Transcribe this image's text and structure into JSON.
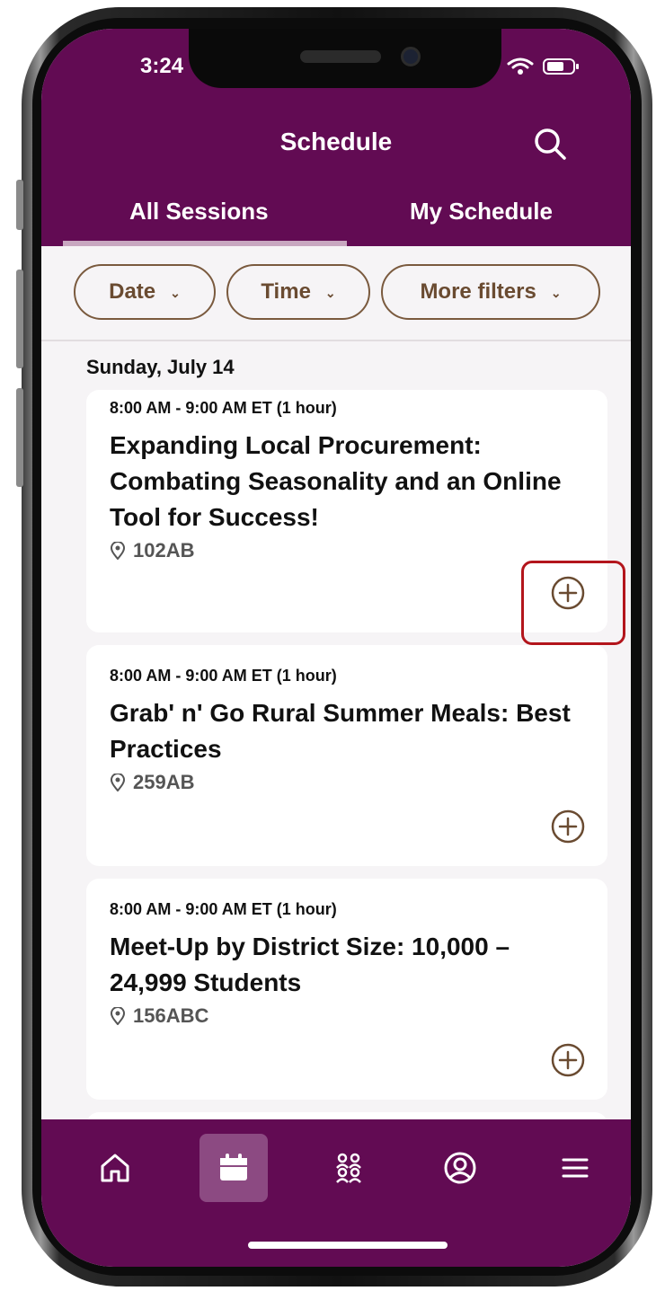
{
  "status": {
    "time": "3:24"
  },
  "header": {
    "title": "Schedule",
    "tabs": [
      {
        "label": "All Sessions",
        "active": true
      },
      {
        "label": "My Schedule",
        "active": false
      }
    ]
  },
  "filters": [
    {
      "label": "Date"
    },
    {
      "label": "Time"
    },
    {
      "label": "More filters"
    }
  ],
  "day_heading": "Sunday, July 14",
  "sessions": [
    {
      "time": "8:00 AM - 9:00 AM ET (1 hour)",
      "title": "Expanding Local Procurement: Combating Seasonality and an Online Tool for Success!",
      "room": "102AB"
    },
    {
      "time": "8:00 AM - 9:00 AM ET (1 hour)",
      "title": "Grab' n' Go Rural Summer Meals: Best Practices",
      "room": "259AB"
    },
    {
      "time": "8:00 AM - 9:00 AM ET (1 hour)",
      "title": "Meet-Up by District Size: 10,000 – 24,999 Students",
      "room": "156ABC"
    }
  ],
  "nav": {
    "items": [
      "home-icon",
      "calendar-icon",
      "people-icon",
      "profile-icon",
      "menu-icon"
    ],
    "active": "calendar-icon"
  },
  "colors": {
    "brand": "#620b53",
    "accent": "#7a5a3e",
    "highlight": "#b3151c"
  }
}
